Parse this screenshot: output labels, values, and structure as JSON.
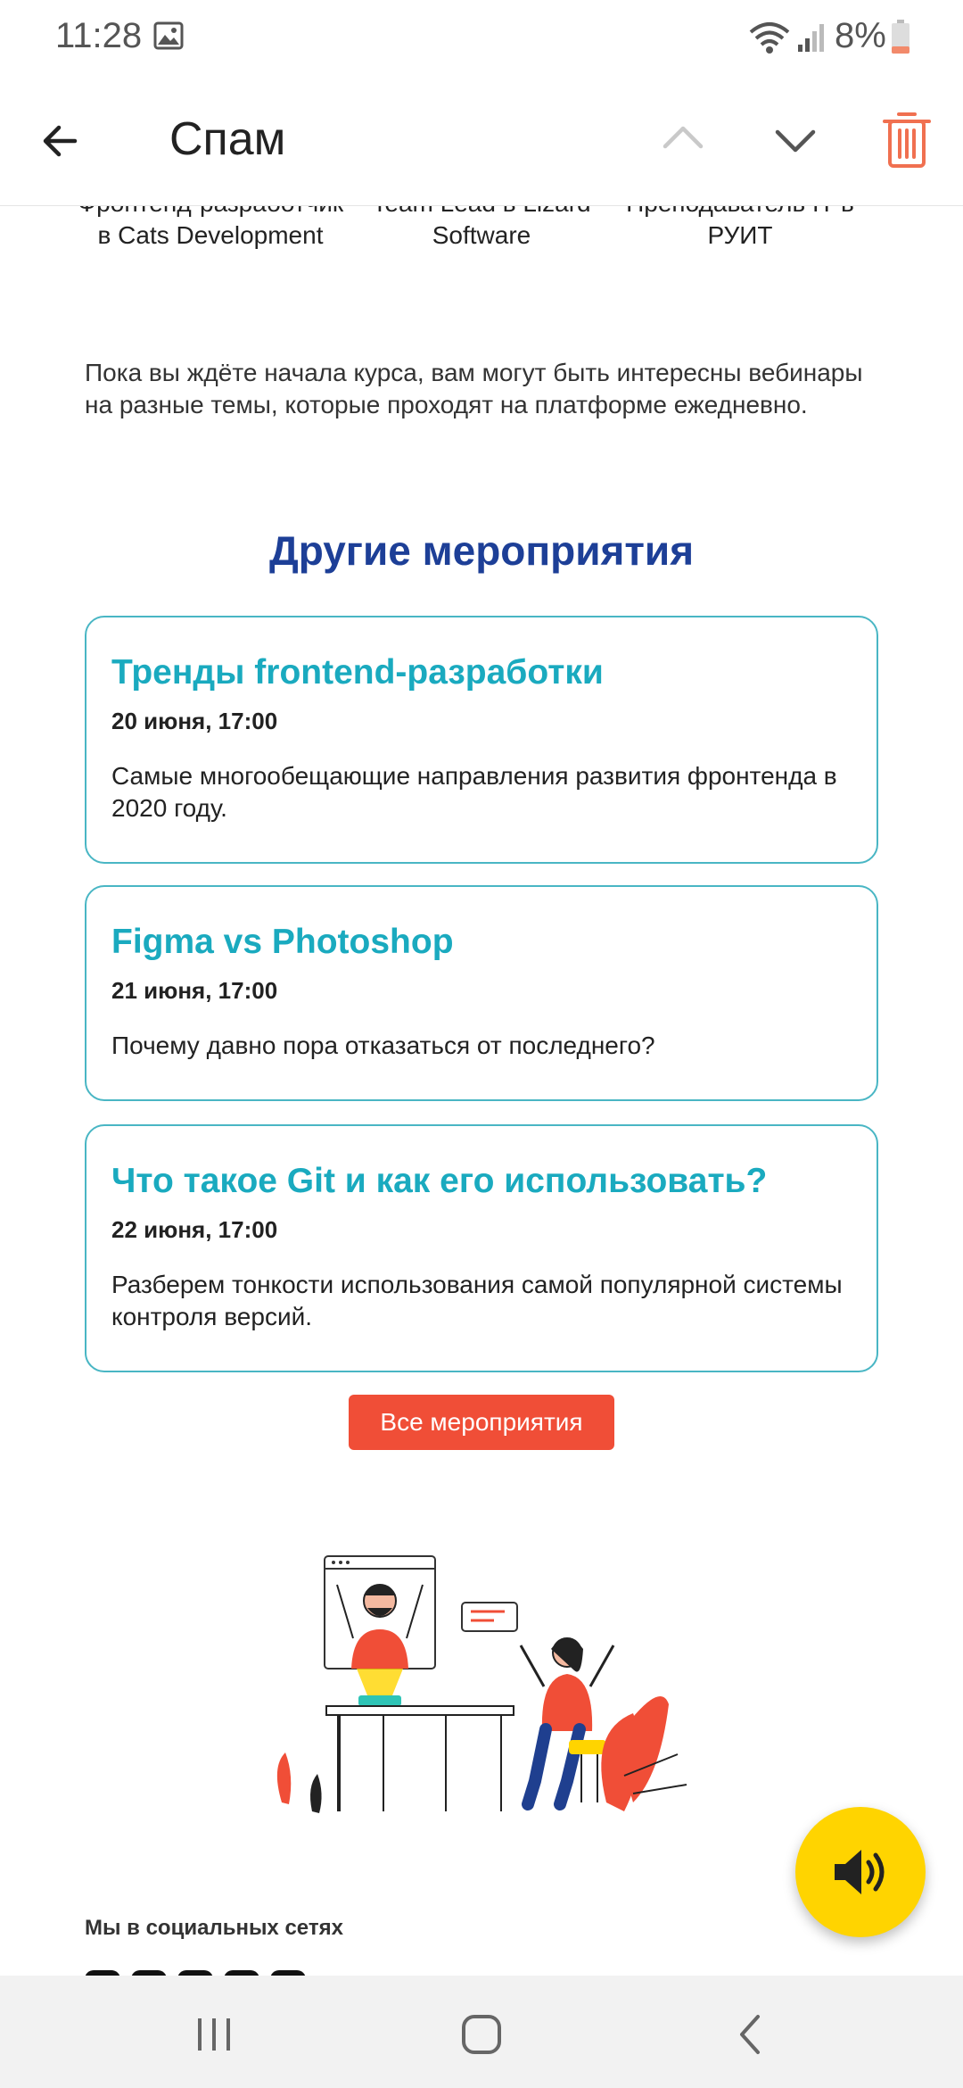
{
  "status_bar": {
    "time": "11:28",
    "battery": "8%"
  },
  "app_bar": {
    "title": "Спам"
  },
  "team": [
    {
      "label": "Фронтенд-разработчик в Cats Development"
    },
    {
      "label": "Team Lead в Lizard Software"
    },
    {
      "label": "Преподаватель IT в РУИТ"
    }
  ],
  "intro_text": "Пока вы ждёте начала курса, вам могут быть интересны вебинары на разные темы, которые проходят на платформе ежедневно.",
  "section_title": "Другие мероприятия",
  "events": [
    {
      "title": "Тренды frontend-разработки",
      "date": "20 июня, 17:00",
      "description": "Самые многообещающие направления развития фронтенда в 2020 году."
    },
    {
      "title": "Figma vs Photoshop",
      "date": "21 июня, 17:00",
      "description": "Почему давно пора отказаться от последнего?"
    },
    {
      "title": "Что такое Git и как его использовать?",
      "date": "22 июня, 17:00",
      "description": "Разберем тонкости использования самой популярной системы контроля версий."
    }
  ],
  "all_events_button": "Все мероприятия",
  "social_label": "Мы в социальных сетях",
  "colors": {
    "accent_red": "#f04e37",
    "heading_blue": "#1d3f97",
    "card_teal": "#1aaabf",
    "fab_yellow": "#ffd400"
  },
  "icons": [
    "gallery-icon",
    "wifi-icon",
    "signal-icon",
    "battery-icon",
    "back-arrow-icon",
    "chevron-up-icon",
    "chevron-down-icon",
    "trash-icon",
    "volume-icon",
    "recent-apps-icon",
    "home-icon",
    "back-nav-icon"
  ]
}
